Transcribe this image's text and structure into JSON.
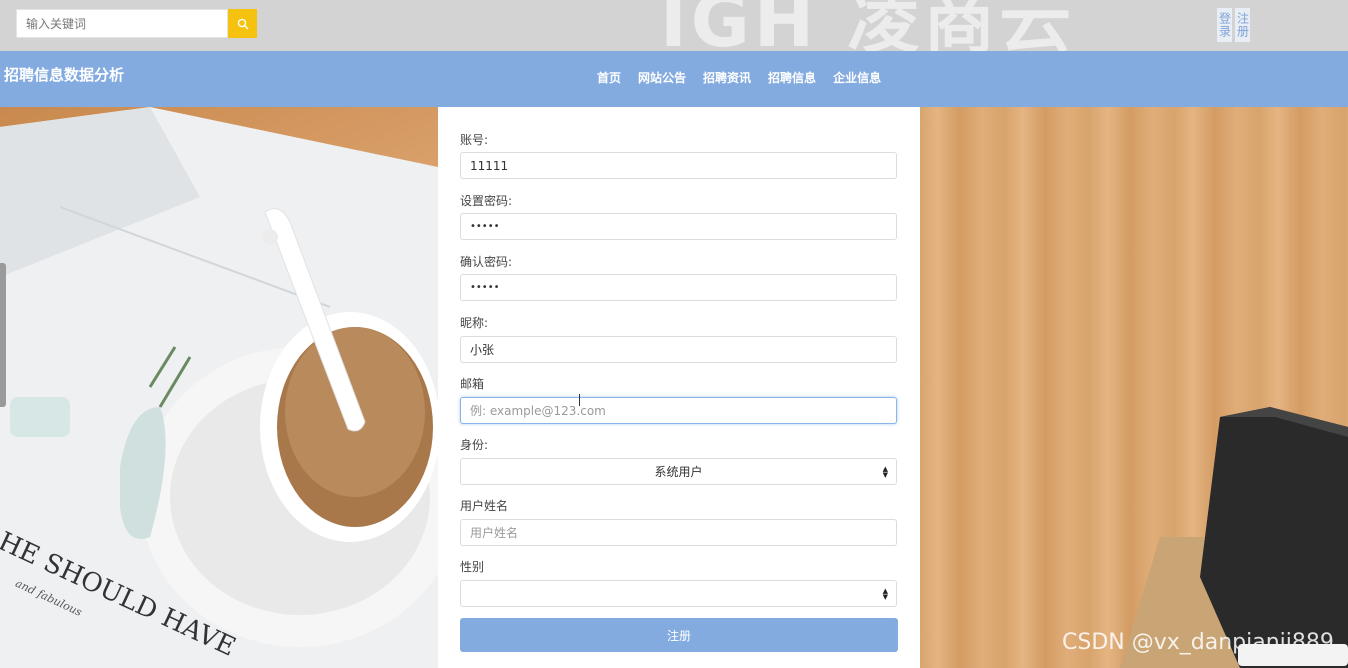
{
  "header": {
    "search": {
      "placeholder": "输入关键词"
    },
    "auth": {
      "login": "登录",
      "register": "注册"
    }
  },
  "navbar": {
    "site_title": "招聘信息数据分析",
    "items": [
      "首页",
      "网站公告",
      "招聘资讯",
      "招聘信息",
      "企业信息"
    ]
  },
  "form": {
    "account": {
      "label": "账号:",
      "value": "11111"
    },
    "password": {
      "label": "设置密码:",
      "value": "•••••"
    },
    "confirm_password": {
      "label": "确认密码:",
      "value": "•••••"
    },
    "nickname": {
      "label": "昵称:",
      "value": "小张"
    },
    "email": {
      "label": "邮箱",
      "placeholder": "例: example@123.com"
    },
    "identity": {
      "label": "身份:",
      "selected": "系统用户"
    },
    "username": {
      "label": "用户姓名",
      "placeholder": "用户姓名"
    },
    "gender": {
      "label": "性别",
      "selected": ""
    },
    "submit_label": "注册"
  },
  "watermark": "CSDN @vx_danpianji889",
  "colors": {
    "accent": "#83abe0",
    "search_button": "#f5c20f"
  }
}
